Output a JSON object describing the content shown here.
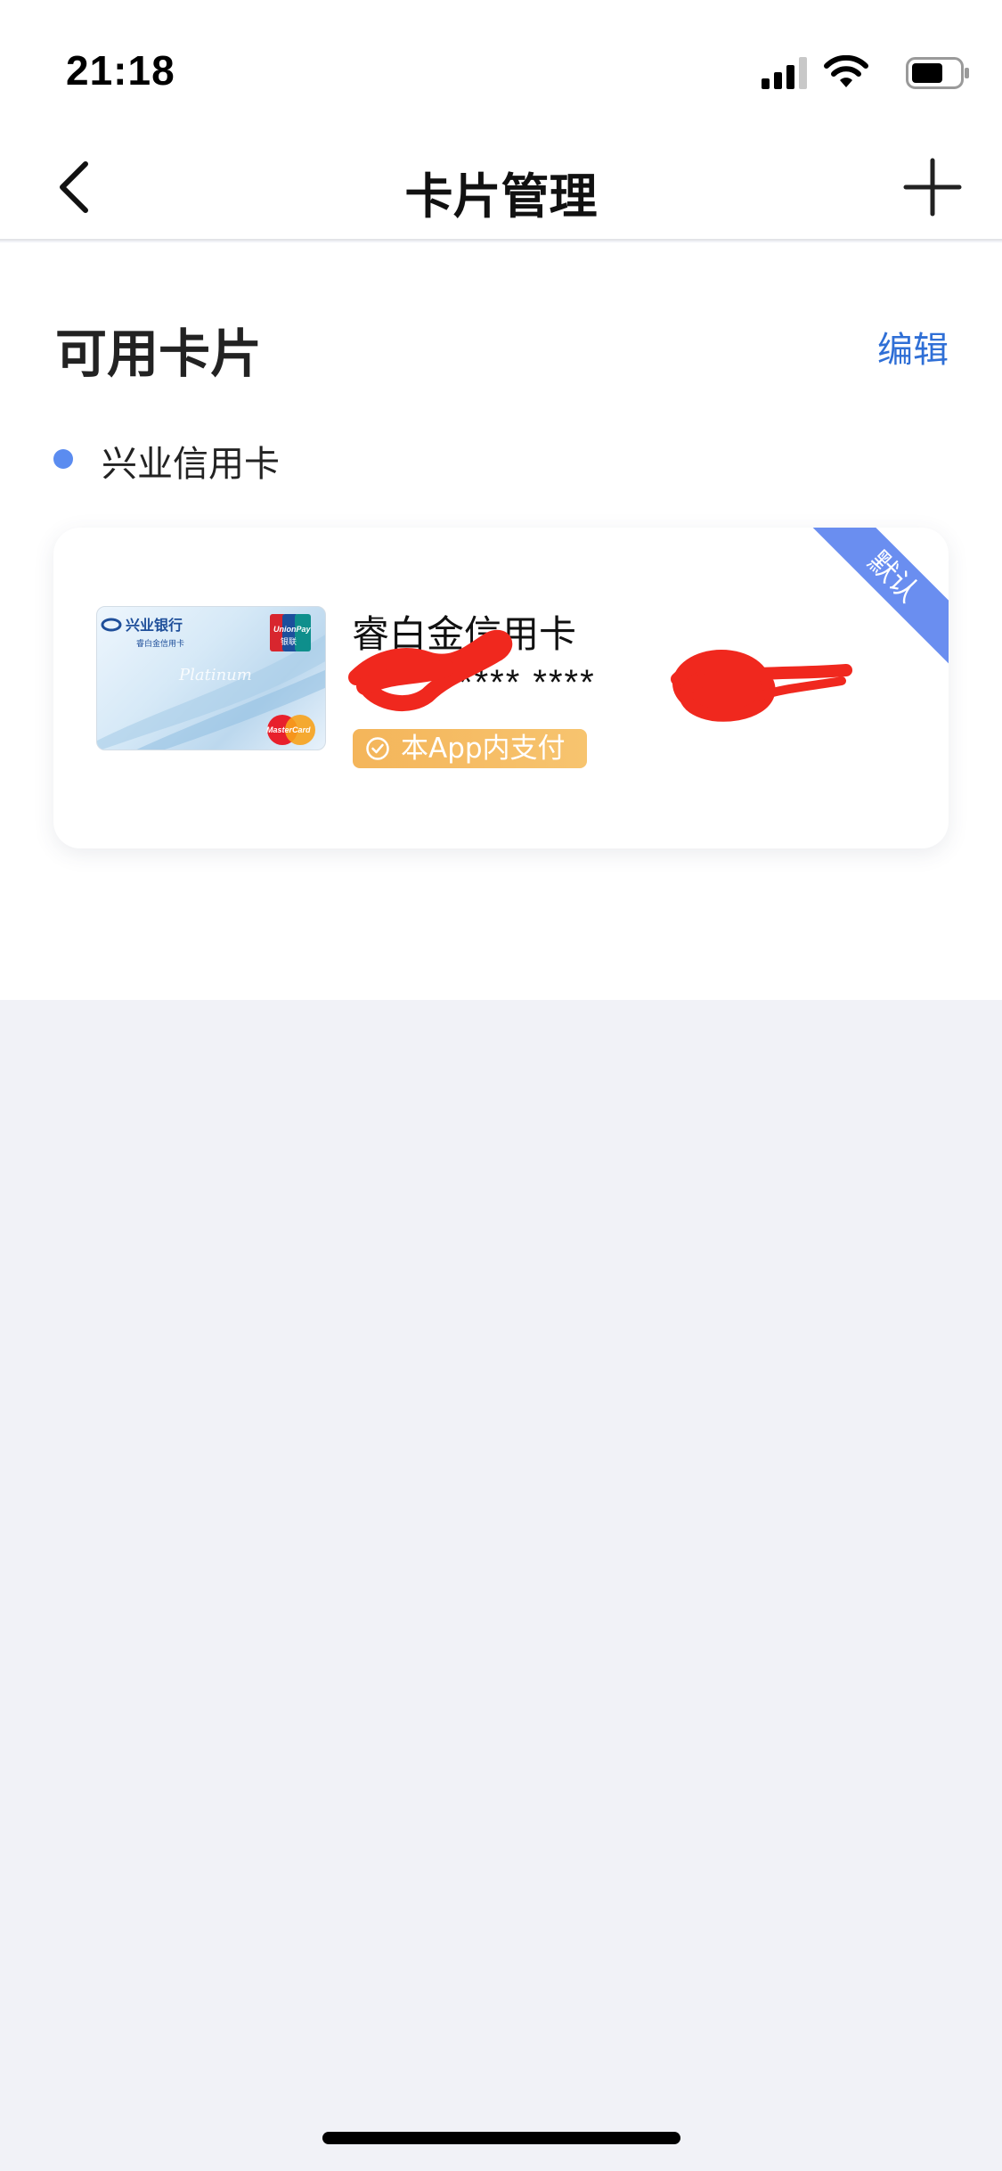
{
  "status_bar": {
    "time": "21:18",
    "icons": [
      "signal-icon",
      "wifi-icon",
      "battery-icon"
    ]
  },
  "nav": {
    "title": "卡片管理",
    "back_icon": "chevron-left-icon",
    "add_icon": "plus-icon"
  },
  "section": {
    "title": "可用卡片",
    "edit_label": "编辑"
  },
  "group": {
    "label": "兴业信用卡"
  },
  "card": {
    "name": "睿白金信用卡",
    "number_masked": "**** ****",
    "badge": "本App内支付",
    "default_label": "默认",
    "thumb_bank_name": "兴业银行",
    "thumb_card_type": "睿白金信用卡",
    "thumb_script": "Platinum",
    "thumb_unionpay": "UnionPay",
    "thumb_unionpay_cn": "银联",
    "thumb_mastercard": "MasterCard"
  },
  "colors": {
    "accent": "#2f6fd6",
    "dot": "#5b8cf0",
    "ribbon": "#6a8ef0",
    "badge": "#f4b55a",
    "background": "#f1f2f7"
  }
}
